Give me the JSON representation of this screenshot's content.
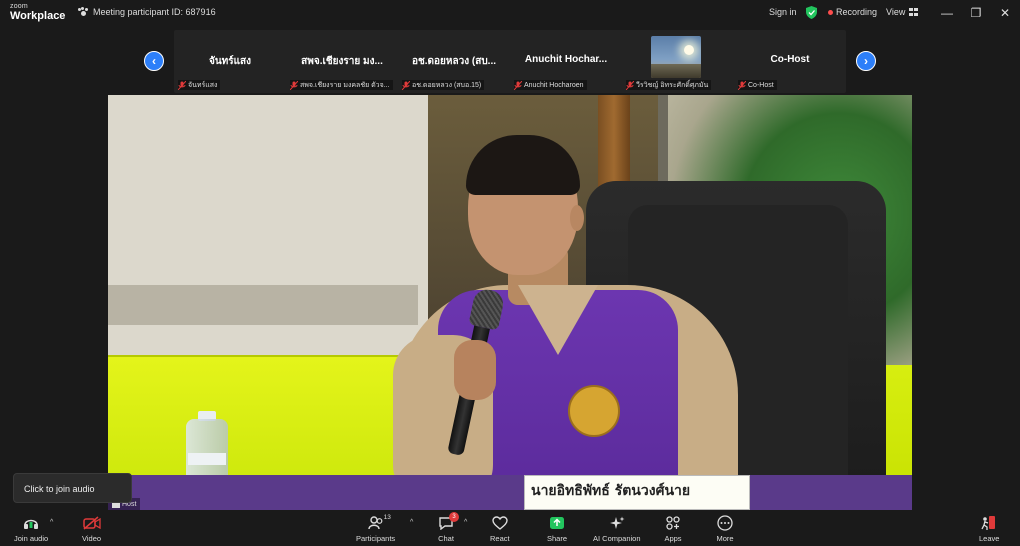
{
  "app": {
    "brand_top": "zoom",
    "brand_bottom": "Workplace"
  },
  "titlebar": {
    "meeting_id": "Meeting participant ID: 687916",
    "sign_in": "Sign in",
    "recording": "Recording",
    "view": "View",
    "minimize": "—",
    "restore": "❐",
    "close": "✕"
  },
  "strip": {
    "prev": "‹",
    "next": "›",
    "tiles": [
      {
        "name": "จันทร์แสง",
        "label": "จันทร์แสง"
      },
      {
        "name": "สพจ.เชียงราย มง...",
        "label": "สพจ.เชียงราย มงคลชัย ตัวจ..."
      },
      {
        "name": "อช.ดอยหลวง (สบ...",
        "label": "อช.ดอยหลวง (สบอ.15)"
      },
      {
        "name": "Anuchit  Hochar...",
        "label": "Anuchit Hocharoen"
      },
      {
        "name": "",
        "label": "วีรวิชญ์ อิทระศักดิ์ศุภมัน"
      },
      {
        "name": "Co-Host",
        "label": "Co-Host"
      }
    ]
  },
  "video": {
    "nameplate": "นายอิทธิพัทธ์ รัตนวงศ์นาย",
    "host_tag": "Host"
  },
  "tooltip": {
    "text": "Click to join audio"
  },
  "toolbar": {
    "join_audio": "Join audio",
    "video": "Video",
    "participants": "Participants",
    "participants_count": "13",
    "chat": "Chat",
    "chat_badge": "3",
    "react": "React",
    "share": "Share",
    "ai_companion": "AI Companion",
    "apps": "Apps",
    "more": "More",
    "leave": "Leave",
    "caret": "^"
  },
  "colors": {
    "accent": "#2d7ff9",
    "share": "#22c55e",
    "record": "#ff4d4d",
    "leave": "#e03a3a",
    "mute": "#e03a3a"
  }
}
